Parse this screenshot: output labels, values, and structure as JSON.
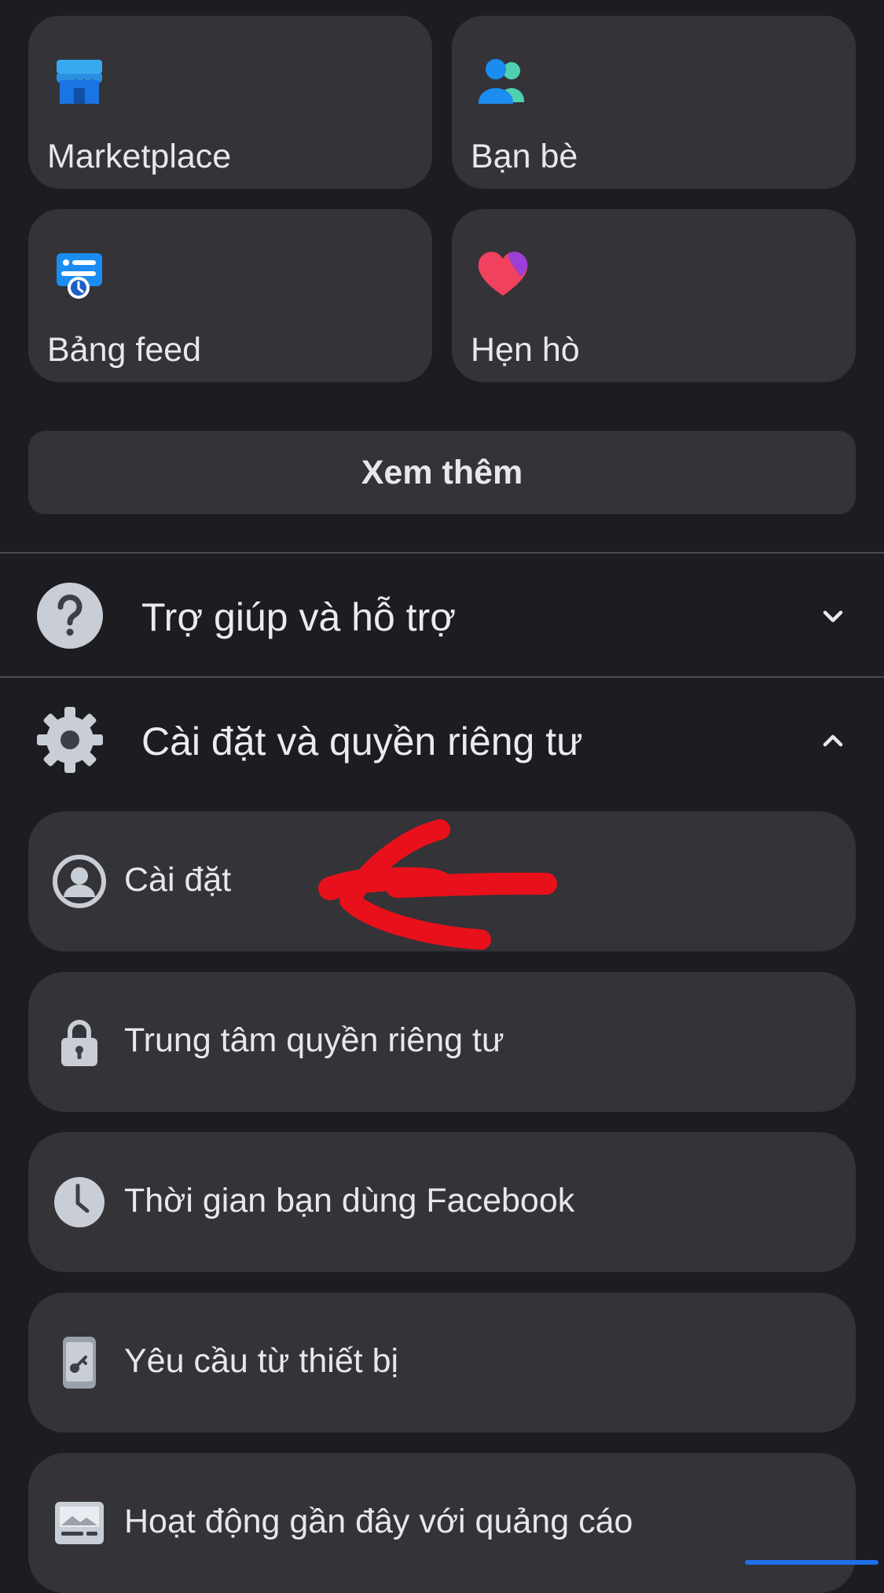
{
  "shortcuts": [
    {
      "label": "Marketplace",
      "icon": "marketplace-icon"
    },
    {
      "label": "Bạn bè",
      "icon": "friends-icon"
    },
    {
      "label": "Bảng feed",
      "icon": "feeds-icon"
    },
    {
      "label": "Hẹn hò",
      "icon": "dating-heart-icon"
    }
  ],
  "see_more_label": "Xem thêm",
  "sections": {
    "help": {
      "label": "Trợ giúp và hỗ trợ",
      "icon": "question-icon",
      "state": "collapsed"
    },
    "settings": {
      "label": "Cài đặt và quyền riêng tư",
      "icon": "gear-icon",
      "state": "expanded"
    }
  },
  "settings_items": [
    {
      "label": "Cài đặt",
      "icon": "user-circle-icon"
    },
    {
      "label": "Trung tâm quyền riêng tư",
      "icon": "lock-icon"
    },
    {
      "label": "Thời gian bạn dùng Facebook",
      "icon": "clock-icon"
    },
    {
      "label": "Yêu cầu từ thiết bị",
      "icon": "phone-key-icon"
    },
    {
      "label": "Hoạt động gần đây với quảng cáo",
      "icon": "ad-image-icon"
    }
  ],
  "colors": {
    "background": "#1c1c21",
    "card": "#333338",
    "annotation_arrow": "#e8101a",
    "accent_blue": "#1f6fe8"
  }
}
